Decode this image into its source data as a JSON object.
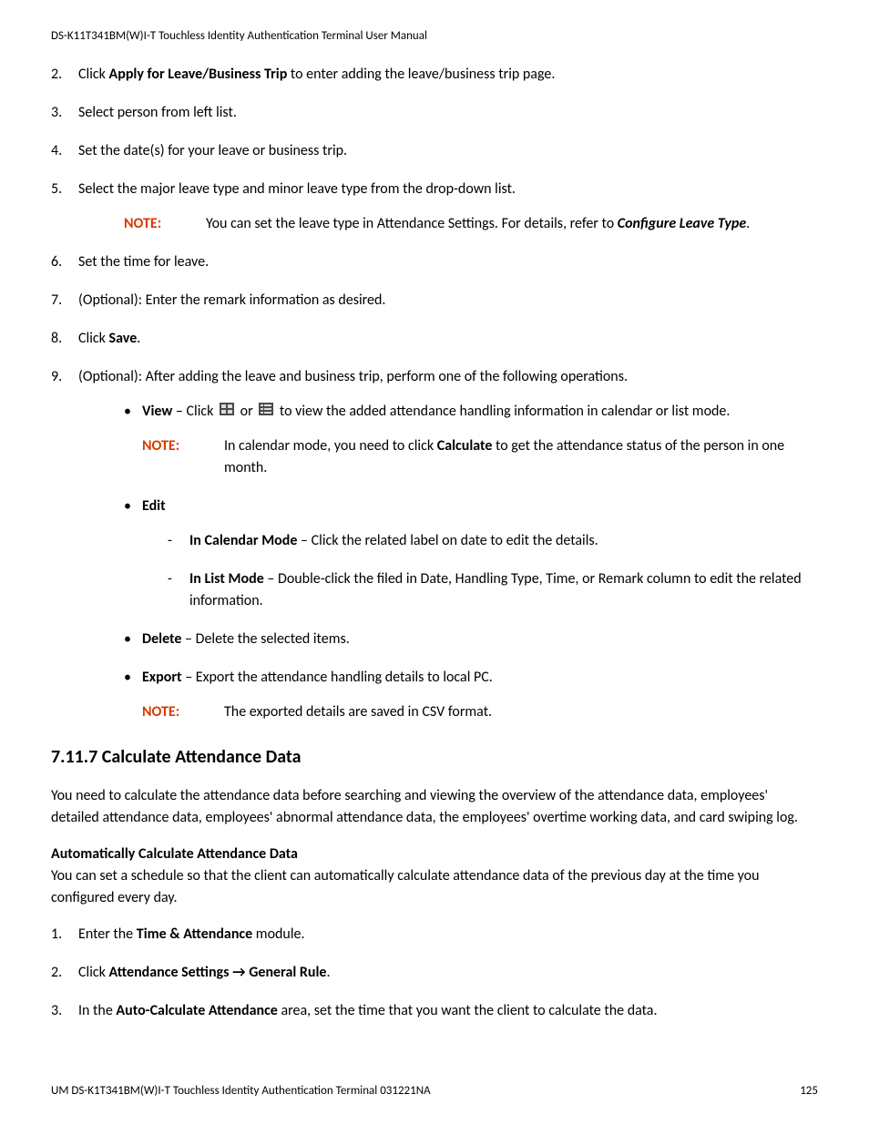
{
  "header": "DS-K11T341BM(W)I-T Touchless Identity Authentication Terminal User Manual",
  "steps": {
    "s2": {
      "n": "2.",
      "pre": "Click ",
      "bold": "Apply for Leave/Business Trip",
      "post": " to enter adding the leave/business trip page."
    },
    "s3": {
      "n": "3.",
      "text": "Select person from left list."
    },
    "s4": {
      "n": "4.",
      "text": "Set the date(s) for your leave or business trip."
    },
    "s5": {
      "n": "5.",
      "text": "Select the major leave type and minor leave type from the drop-down list."
    },
    "s5note": {
      "label": "NOTE:",
      "pre": "You can set the leave type in Attendance Settings. For details, refer to ",
      "ref": "Configure Leave Type",
      "post": "."
    },
    "s6": {
      "n": "6.",
      "text": "Set the time for leave."
    },
    "s7": {
      "n": "7.",
      "text": "(Optional): Enter the remark information as desired."
    },
    "s8": {
      "n": "8.",
      "pre": "Click ",
      "bold": "Save",
      "post": "."
    },
    "s9": {
      "n": "9.",
      "text": "(Optional): After adding the leave and business trip, perform one of the following operations."
    }
  },
  "bullets": {
    "view": {
      "bold": "View",
      "pre": " – Click  ",
      "mid": "  or  ",
      "post": "  to view the added attendance handling information in calendar or list mode."
    },
    "viewnote": {
      "label": "NOTE:",
      "pre": "In calendar mode, you need to click ",
      "bold": "Calculate",
      "post": " to get the attendance status of the person in one month."
    },
    "edit": {
      "bold": "Edit"
    },
    "calmode": {
      "bold": "In Calendar Mode",
      "post": " – Click the related label on date to edit the details."
    },
    "listmode": {
      "bold": "In List Mode",
      "post": " – Double-click the filed in Date, Handling Type, Time, or Remark column to edit the related information."
    },
    "delete": {
      "bold": "Delete",
      "post": " – Delete the selected items."
    },
    "export": {
      "bold": "Export",
      "post": " – Export the attendance handling details to local PC."
    },
    "exportnote": {
      "label": "NOTE:",
      "text": "The exported details are saved in CSV format."
    }
  },
  "section": {
    "heading": "7.11.7 Calculate Attendance Data",
    "intro": "You need to calculate the attendance data before searching and viewing the overview of the attendance data, employees' detailed attendance data, employees' abnormal attendance data, the employees' overtime working data, and card swiping log.",
    "subheading": "Automatically Calculate Attendance Data",
    "subtext": "You can set a schedule so that the client can automatically calculate attendance data of the previous day at the time you configured every day."
  },
  "auto": {
    "a1": {
      "n": "1.",
      "pre": "Enter the ",
      "bold": "Time & Attendance",
      "post": " module."
    },
    "a2": {
      "n": "2.",
      "pre": "Click ",
      "bold": "Attendance Settings → General Rule",
      "post": "."
    },
    "a3": {
      "n": "3.",
      "pre": "In the ",
      "bold": "Auto-Calculate Attendance",
      "post": " area, set the time that you want the client to calculate the data."
    }
  },
  "footer": {
    "left": "UM DS-K1T341BM(W)I-T Touchless Identity Authentication Terminal 031221NA",
    "page": "125"
  }
}
